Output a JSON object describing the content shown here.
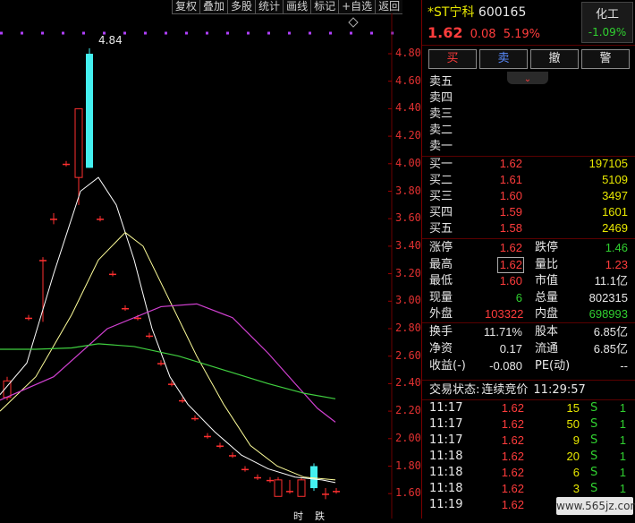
{
  "toolbar": [
    "复权",
    "叠加",
    "多股",
    "统计",
    "画线",
    "标记",
    "+自选",
    "返回"
  ],
  "chart": {
    "y_labels": [
      "4.80",
      "4.60",
      "4.40",
      "4.20",
      "4.00",
      "3.80",
      "3.60",
      "3.40",
      "3.20",
      "3.00",
      "2.80",
      "2.60",
      "2.40",
      "2.20",
      "2.00",
      "1.80",
      "1.60"
    ],
    "high_annotation": "4.84",
    "bottom_markers": [
      "时",
      "跌"
    ],
    "colors": {
      "up": "#ff3030",
      "down": "#44f0f0",
      "ma5": "#ffffff",
      "ma10": "#ffff9a",
      "ma20": "#d040d0",
      "ma60": "#40d040"
    }
  },
  "stock": {
    "name": "*ST宁科",
    "code": "600165",
    "price": "1.62",
    "change": "0.08",
    "pct": "5.19%",
    "sector": "化工",
    "sector_pct": "-1.09%"
  },
  "buttons": [
    "买",
    "卖",
    "撤",
    "警"
  ],
  "asks": [
    {
      "label": "卖五",
      "price": "",
      "vol": ""
    },
    {
      "label": "卖四",
      "price": "",
      "vol": ""
    },
    {
      "label": "卖三",
      "price": "",
      "vol": ""
    },
    {
      "label": "卖二",
      "price": "",
      "vol": ""
    },
    {
      "label": "卖一",
      "price": "",
      "vol": ""
    }
  ],
  "bids": [
    {
      "label": "买一",
      "price": "1.62",
      "vol": "197105"
    },
    {
      "label": "买二",
      "price": "1.61",
      "vol": "5109"
    },
    {
      "label": "买三",
      "price": "1.60",
      "vol": "3497"
    },
    {
      "label": "买四",
      "price": "1.59",
      "vol": "1601"
    },
    {
      "label": "买五",
      "price": "1.58",
      "vol": "2469"
    }
  ],
  "quote": [
    {
      "l1": "涨停",
      "v1": "1.62",
      "c1": "red",
      "l2": "跌停",
      "v2": "1.46",
      "c2": "green"
    },
    {
      "l1": "最高",
      "v1": "1.62",
      "c1": "red",
      "l2": "量比",
      "v2": "1.23",
      "c2": "red"
    },
    {
      "l1": "最低",
      "v1": "1.60",
      "c1": "red",
      "l2": "市值",
      "v2": "11.1亿",
      "c2": "white"
    },
    {
      "l1": "现量",
      "v1": "6",
      "c1": "green",
      "l2": "总量",
      "v2": "802315",
      "c2": "white"
    },
    {
      "l1": "外盘",
      "v1": "103322",
      "c1": "red",
      "l2": "内盘",
      "v2": "698993",
      "c2": "green"
    }
  ],
  "fund": [
    {
      "l1": "换手",
      "v1": "11.71%",
      "l2": "股本",
      "v2": "6.85亿"
    },
    {
      "l1": "净资",
      "v1": "0.17",
      "l2": "流通",
      "v2": "6.85亿"
    },
    {
      "l1": "收益(-)",
      "v1": "-0.080",
      "l2": "PE(动)",
      "v2": "--"
    }
  ],
  "trade_status": {
    "label": "交易状态:",
    "value": "连续竞价",
    "time": "11:29:57"
  },
  "ticks": [
    {
      "t": "11:17",
      "p": "1.62",
      "v": "15",
      "s": "S",
      "n": "1"
    },
    {
      "t": "11:17",
      "p": "1.62",
      "v": "50",
      "s": "S",
      "n": "1"
    },
    {
      "t": "11:17",
      "p": "1.62",
      "v": "9",
      "s": "S",
      "n": "1"
    },
    {
      "t": "11:18",
      "p": "1.62",
      "v": "20",
      "s": "S",
      "n": "1"
    },
    {
      "t": "11:18",
      "p": "1.62",
      "v": "6",
      "s": "S",
      "n": "1"
    },
    {
      "t": "11:18",
      "p": "1.62",
      "v": "3",
      "s": "S",
      "n": "1"
    },
    {
      "t": "11:19",
      "p": "1.62",
      "v": "10",
      "s": "S",
      "n": "1"
    }
  ]
}
